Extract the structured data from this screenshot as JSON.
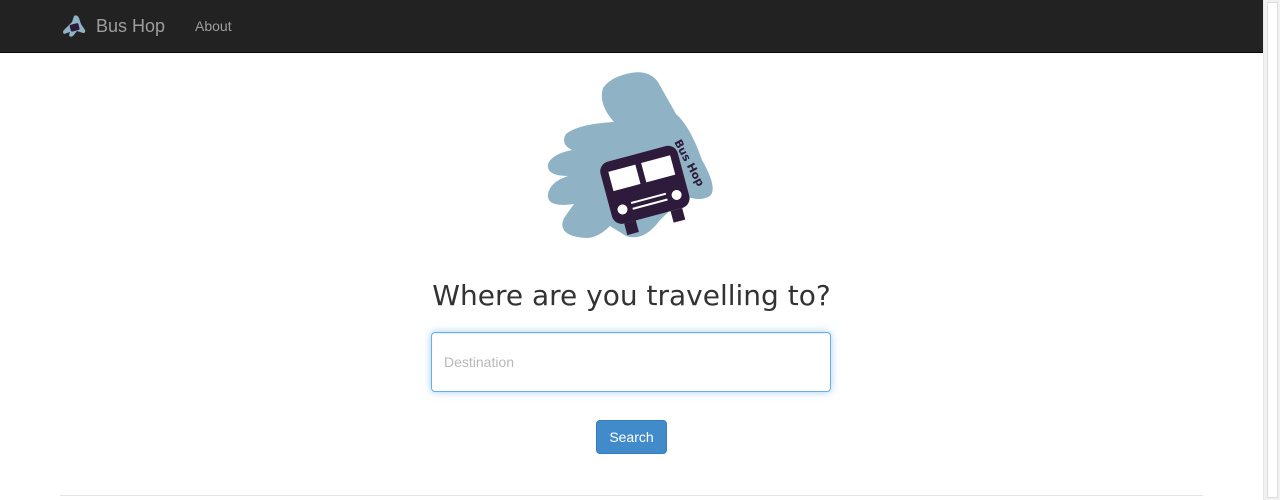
{
  "navbar": {
    "brand_label": "Bus Hop",
    "brand_icon": "hand-bus-icon",
    "links": [
      {
        "label": "About"
      }
    ]
  },
  "main": {
    "logo": {
      "icon": "hand-holding-bus-logo",
      "text": "Bus Hop"
    },
    "heading": "Where are you travelling to?",
    "destination": {
      "placeholder": "Destination",
      "value": ""
    },
    "search_label": "Search"
  },
  "colors": {
    "navbar_bg": "#222222",
    "nav_text": "#9d9d9d",
    "hand": "#8fb3c5",
    "bus": "#2e1a3a",
    "primary_button": "#428bca",
    "input_focus": "#66afe9"
  }
}
